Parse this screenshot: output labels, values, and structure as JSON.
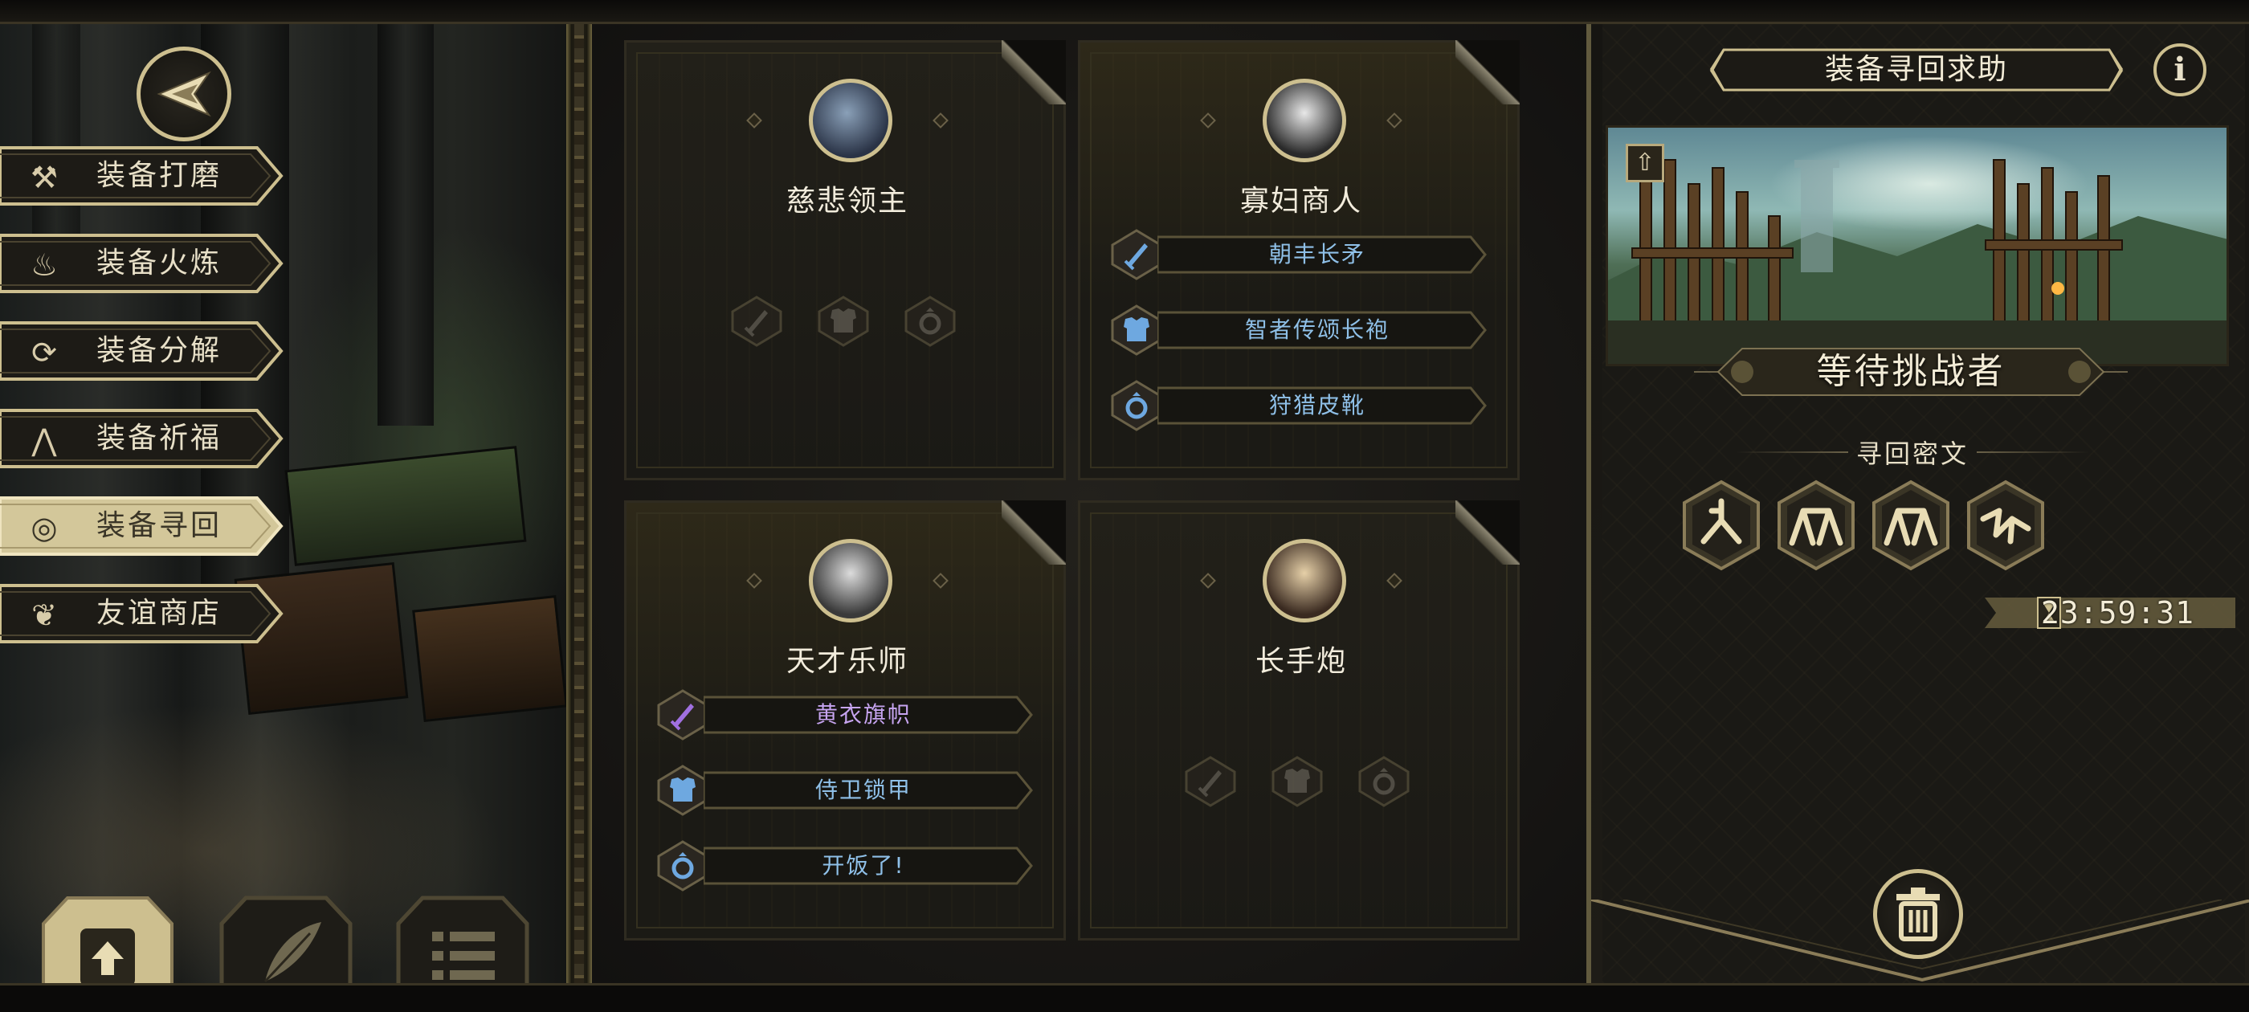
{
  "sidebar": {
    "items": [
      {
        "label": "装备打磨",
        "icon": "hammer-icon",
        "active": false
      },
      {
        "label": "装备火炼",
        "icon": "flame-icon",
        "active": false
      },
      {
        "label": "装备分解",
        "icon": "disassemble-icon",
        "active": false
      },
      {
        "label": "装备祈福",
        "icon": "pray-hands-icon",
        "active": false
      },
      {
        "label": "装备寻回",
        "icon": "retrieve-target-icon",
        "active": true
      },
      {
        "label": "友谊商店",
        "icon": "fox-icon",
        "active": false
      }
    ],
    "bottom_tabs": [
      {
        "icon": "upload-icon",
        "active": true
      },
      {
        "icon": "feather-icon",
        "active": false
      },
      {
        "icon": "list-icon",
        "active": false
      }
    ]
  },
  "characters": [
    {
      "name": "慈悲领主",
      "equipment": []
    },
    {
      "name": "寡妇商人",
      "equipment": [
        {
          "label": "朝丰长矛",
          "icon": "sword-icon",
          "tier": "blue"
        },
        {
          "label": "智者传颂长袍",
          "icon": "armor-icon",
          "tier": "blue"
        },
        {
          "label": "狩猎皮靴",
          "icon": "ring-icon",
          "tier": "blue"
        }
      ]
    },
    {
      "name": "天才乐师",
      "equipment": [
        {
          "label": "黄衣旗帜",
          "icon": "sword-icon",
          "tier": "purple"
        },
        {
          "label": "侍卫锁甲",
          "icon": "armor-icon",
          "tier": "blue"
        },
        {
          "label": "开饭了!",
          "icon": "ring-icon",
          "tier": "blue"
        }
      ]
    },
    {
      "name": "长手炮",
      "equipment": []
    }
  ],
  "right_panel": {
    "title": "装备寻回求助",
    "info_icon": "info-icon",
    "status": "等待挑战者",
    "section_title": "寻回密文",
    "runes": [
      "rune-1-icon",
      "rune-2-icon",
      "rune-3-icon",
      "rune-4-icon"
    ],
    "timer": "23:59:31",
    "trash_icon": "trash-icon"
  },
  "colors": {
    "gold": "#cdbf8f",
    "blue_item": "#8fc0e8",
    "purple_item": "#c6a4f0",
    "text_light": "#f2ecdc"
  }
}
